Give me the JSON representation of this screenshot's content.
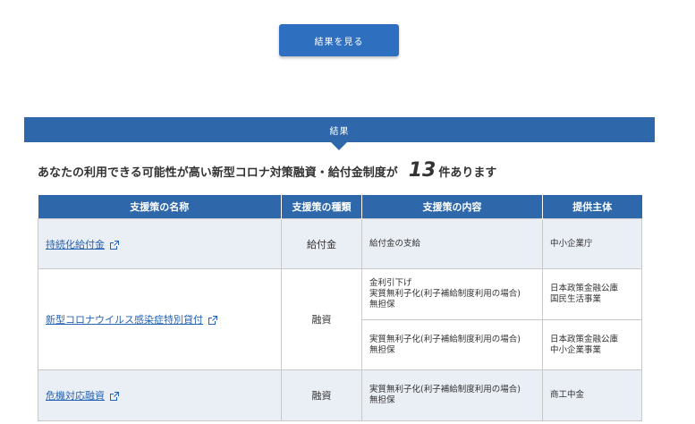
{
  "button": {
    "label": "結果を見る"
  },
  "banner": {
    "label": "結果"
  },
  "summary": {
    "prefix": "あなたの利用できる可能性が高い新型コロナ対策融資・給付金制度が",
    "count": "13",
    "suffix": "件あります"
  },
  "table": {
    "headers": [
      "支援策の名称",
      "支援策の種類",
      "支援策の内容",
      "提供主体"
    ],
    "rows": [
      {
        "name": "持続化給付金",
        "type": "給付金",
        "content": [
          "給付金の支給"
        ],
        "provider": [
          "中小企業庁"
        ]
      },
      {
        "name": "新型コロナウイルス感染症特別貸付",
        "type": "融資",
        "content": [
          "金利引下げ",
          "実質無利子化(利子補給制度利用の場合)",
          "無担保"
        ],
        "provider": [
          "日本政策金融公庫",
          "国民生活事業"
        ]
      },
      {
        "content": [
          "実質無利子化(利子補給制度利用の場合)",
          "無担保"
        ],
        "provider": [
          "日本政策金融公庫",
          "中小企業事業"
        ]
      },
      {
        "name": "危機対応融資",
        "type": "融資",
        "content": [
          "実質無利子化(利子補給制度利用の場合)",
          "無担保"
        ],
        "provider": [
          "商工中金"
        ]
      }
    ]
  },
  "icons": {
    "external_link": "external-link-icon"
  },
  "colors": {
    "primary": "#2e68aa",
    "link": "#2763b4",
    "row_shade": "#eaeef5"
  }
}
